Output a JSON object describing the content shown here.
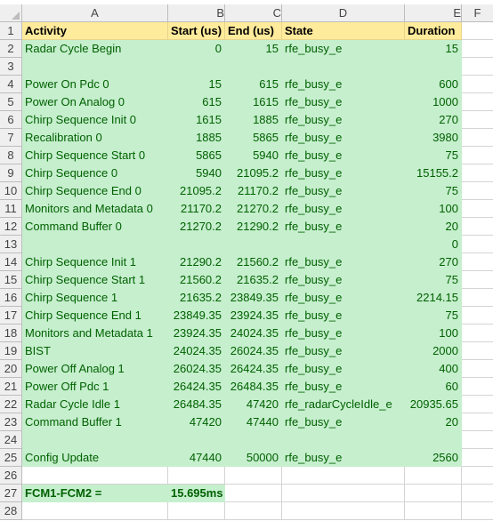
{
  "columns": [
    "A",
    "B",
    "C",
    "D",
    "E",
    "F"
  ],
  "headers": {
    "activity": "Activity",
    "start": "Start (us)",
    "end": "End (us)",
    "state": "State",
    "duration": "Duration"
  },
  "rows": [
    {
      "num": "2",
      "activity": "Radar Cycle Begin",
      "start": "0",
      "end": "15",
      "state": "rfe_busy_e",
      "duration": "15"
    },
    {
      "num": "3",
      "activity": "",
      "start": "",
      "end": "",
      "state": "",
      "duration": ""
    },
    {
      "num": "4",
      "activity": "Power On Pdc 0",
      "start": "15",
      "end": "615",
      "state": "rfe_busy_e",
      "duration": "600"
    },
    {
      "num": "5",
      "activity": "Power On Analog 0",
      "start": "615",
      "end": "1615",
      "state": "rfe_busy_e",
      "duration": "1000"
    },
    {
      "num": "6",
      "activity": "Chirp Sequence Init 0",
      "start": "1615",
      "end": "1885",
      "state": "rfe_busy_e",
      "duration": "270"
    },
    {
      "num": "7",
      "activity": "Recalibration 0",
      "start": "1885",
      "end": "5865",
      "state": "rfe_busy_e",
      "duration": "3980"
    },
    {
      "num": "8",
      "activity": "Chirp Sequence Start 0",
      "start": "5865",
      "end": "5940",
      "state": "rfe_busy_e",
      "duration": "75"
    },
    {
      "num": "9",
      "activity": "Chirp Sequence 0",
      "start": "5940",
      "end": "21095.2",
      "state": "rfe_busy_e",
      "duration": "15155.2"
    },
    {
      "num": "10",
      "activity": "Chirp Sequence End 0",
      "start": "21095.2",
      "end": "21170.2",
      "state": "rfe_busy_e",
      "duration": "75"
    },
    {
      "num": "11",
      "activity": "Monitors and Metadata 0",
      "start": "21170.2",
      "end": "21270.2",
      "state": "rfe_busy_e",
      "duration": "100"
    },
    {
      "num": "12",
      "activity": "Command Buffer 0",
      "start": "21270.2",
      "end": "21290.2",
      "state": "rfe_busy_e",
      "duration": "20"
    },
    {
      "num": "13",
      "activity": "",
      "start": "",
      "end": "",
      "state": "",
      "duration": "0"
    },
    {
      "num": "14",
      "activity": "Chirp Sequence Init 1",
      "start": "21290.2",
      "end": "21560.2",
      "state": "rfe_busy_e",
      "duration": "270"
    },
    {
      "num": "15",
      "activity": "Chirp Sequence Start 1",
      "start": "21560.2",
      "end": "21635.2",
      "state": "rfe_busy_e",
      "duration": "75"
    },
    {
      "num": "16",
      "activity": "Chirp Sequence 1",
      "start": "21635.2",
      "end": "23849.35",
      "state": "rfe_busy_e",
      "duration": "2214.15"
    },
    {
      "num": "17",
      "activity": "Chirp Sequence End 1",
      "start": "23849.35",
      "end": "23924.35",
      "state": "rfe_busy_e",
      "duration": "75"
    },
    {
      "num": "18",
      "activity": "Monitors and Metadata 1",
      "start": "23924.35",
      "end": "24024.35",
      "state": "rfe_busy_e",
      "duration": "100"
    },
    {
      "num": "19",
      "activity": "BIST",
      "start": "24024.35",
      "end": "26024.35",
      "state": "rfe_busy_e",
      "duration": "2000"
    },
    {
      "num": "20",
      "activity": "Power Off Analog 1",
      "start": "26024.35",
      "end": "26424.35",
      "state": "rfe_busy_e",
      "duration": "400"
    },
    {
      "num": "21",
      "activity": "Power Off Pdc 1",
      "start": "26424.35",
      "end": "26484.35",
      "state": "rfe_busy_e",
      "duration": "60"
    },
    {
      "num": "22",
      "activity": "Radar Cycle Idle 1",
      "start": "26484.35",
      "end": "47420",
      "state": "rfe_radarCycleIdle_e",
      "duration": "20935.65"
    },
    {
      "num": "23",
      "activity": "Command Buffer 1",
      "start": "47420",
      "end": "47440",
      "state": "rfe_busy_e",
      "duration": "20"
    },
    {
      "num": "24",
      "activity": "",
      "start": "",
      "end": "",
      "state": "",
      "duration": ""
    },
    {
      "num": "25",
      "activity": "Config Update",
      "start": "47440",
      "end": "50000",
      "state": "rfe_busy_e",
      "duration": "2560"
    }
  ],
  "summary": {
    "label": "FCM1-FCM2 =",
    "value": "15.695ms"
  },
  "row_numbers": {
    "header": "1",
    "blank": "26",
    "summary": "27",
    "last": "28"
  },
  "colors": {
    "header_fill": "#ffeb9c",
    "data_fill": "#c6efce",
    "data_text": "#006100"
  }
}
